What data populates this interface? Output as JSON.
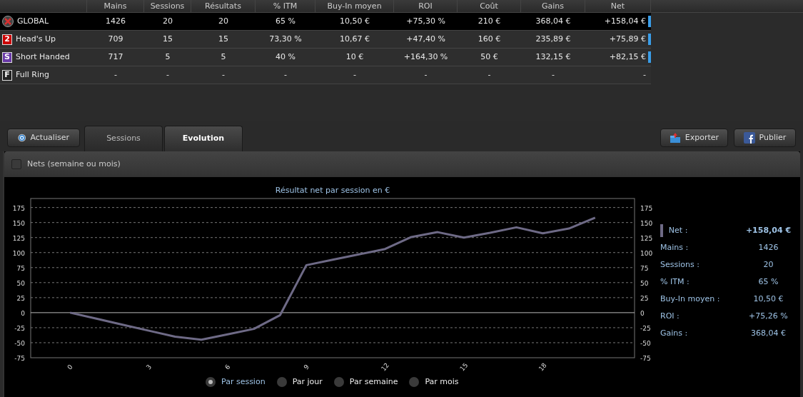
{
  "table": {
    "columns": [
      "Mains",
      "Sessions",
      "Résultats",
      "% ITM",
      "Buy-In moyen",
      "ROI",
      "Coût",
      "Gains",
      "Net"
    ],
    "rows": [
      {
        "kind": "logo",
        "label": "GLOBAL",
        "selected": true,
        "net_marker": true,
        "cells": [
          "1426",
          "20",
          "20",
          "65 %",
          "10,50 €",
          "+75,30 %",
          "210 €",
          "368,04 €",
          "+158,04 €"
        ]
      },
      {
        "kind": "letter",
        "badge": "2",
        "color": "#cc0000",
        "label": "Head's Up",
        "selected": false,
        "net_marker": true,
        "cells": [
          "709",
          "15",
          "15",
          "73,30 %",
          "10,67 €",
          "+47,40 %",
          "160 €",
          "235,89 €",
          "+75,89 €"
        ]
      },
      {
        "kind": "letter",
        "badge": "S",
        "color": "#6a3aa8",
        "label": "Short Handed",
        "selected": false,
        "net_marker": true,
        "cells": [
          "717",
          "5",
          "5",
          "40 %",
          "10 €",
          "+164,30 %",
          "50 €",
          "132,15 €",
          "+82,15 €"
        ]
      },
      {
        "kind": "letter",
        "badge": "F",
        "color": "#222222",
        "label": "Full Ring",
        "selected": false,
        "net_marker": false,
        "cells": [
          "-",
          "-",
          "-",
          "-",
          "-",
          "-",
          "-",
          "-",
          "-"
        ]
      }
    ]
  },
  "toolbar": {
    "refresh": "Actualiser",
    "tabs": [
      {
        "label": "Sessions",
        "selected": false
      },
      {
        "label": "Evolution",
        "selected": true
      }
    ],
    "export": "Exporter",
    "publish": "Publier"
  },
  "filter": {
    "label": "Nets (semaine ou mois)",
    "checked": false
  },
  "chart": {
    "chart_data": {
      "type": "line",
      "title": "Résultat net par session en €",
      "x": [
        0,
        1,
        2,
        3,
        4,
        5,
        6,
        7,
        8,
        9,
        10,
        11,
        12,
        13,
        14,
        15,
        16,
        17,
        18,
        19,
        20
      ],
      "series": [
        {
          "color": "#6e6a86",
          "values": [
            0,
            -10,
            -20,
            -30,
            -40,
            -45,
            -36,
            -27,
            -4,
            79,
            88,
            97,
            106,
            126,
            134,
            125,
            133,
            142,
            132,
            140,
            158
          ]
        }
      ],
      "xlim": [
        -1.5,
        21.5
      ],
      "ylim": [
        -75,
        190
      ],
      "grid": true,
      "xticks": [
        0,
        3,
        6,
        9,
        12,
        15,
        18
      ],
      "yticks": [
        -75,
        -50,
        -25,
        0,
        25,
        50,
        75,
        100,
        125,
        150,
        175
      ]
    },
    "left_axis_labels": [
      "175",
      "150",
      "125",
      "100",
      "75",
      "50",
      "25",
      "0",
      "-25",
      "-50",
      "-75"
    ]
  },
  "stats": [
    {
      "label": "Net :",
      "value": "+158,04 €",
      "legend": true
    },
    {
      "label": "Mains :",
      "value": "1426",
      "legend": false
    },
    {
      "label": "Sessions :",
      "value": "20",
      "legend": false
    },
    {
      "label": "% ITM :",
      "value": "65 %",
      "legend": false
    },
    {
      "label": "Buy-In moyen :",
      "value": "10,50 €",
      "legend": false
    },
    {
      "label": "ROI :",
      "value": "+75,26 %",
      "legend": false
    },
    {
      "label": "Gains :",
      "value": "368,04 €",
      "legend": false
    }
  ],
  "grouping": [
    {
      "label": "Par session",
      "selected": true
    },
    {
      "label": "Par jour",
      "selected": false
    },
    {
      "label": "Par semaine",
      "selected": false
    },
    {
      "label": "Par mois",
      "selected": false
    }
  ]
}
